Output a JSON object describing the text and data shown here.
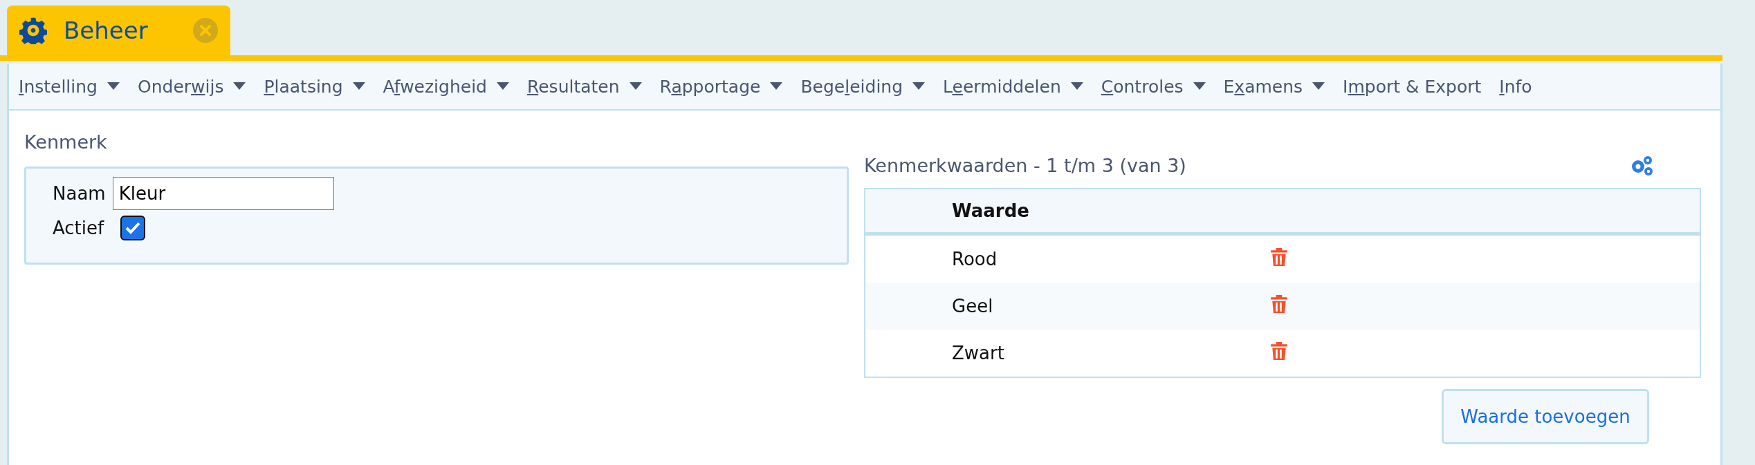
{
  "tab": {
    "title": "Beheer"
  },
  "menu": [
    {
      "key": "I",
      "after": "nstelling",
      "has_menu": true
    },
    {
      "before": "Onder",
      "key": "w",
      "after": "ijs",
      "has_menu": true
    },
    {
      "key": "P",
      "after": "laatsing",
      "has_menu": true
    },
    {
      "before": "A",
      "key": "f",
      "after": "wezigheid",
      "has_menu": true
    },
    {
      "key": "R",
      "after": "esultaten",
      "has_menu": true
    },
    {
      "before": "R",
      "key": "a",
      "after": "pportage",
      "has_menu": true
    },
    {
      "before": "Bege",
      "key": "l",
      "after": "eiding",
      "has_menu": true
    },
    {
      "before": "L",
      "key": "e",
      "after": "ermiddelen",
      "has_menu": true
    },
    {
      "key": "C",
      "after": "ontroles",
      "has_menu": true
    },
    {
      "before": "E",
      "key": "x",
      "after": "amens",
      "has_menu": true
    },
    {
      "before": "I",
      "key": "m",
      "after": "port & Export",
      "has_menu": false
    },
    {
      "key": "I",
      "after": "nfo",
      "has_menu": false
    }
  ],
  "kenmerk": {
    "title": "Kenmerk",
    "name_label": "Naam",
    "name_value": "Kleur",
    "active_label": "Actief",
    "active": true
  },
  "values": {
    "title": "Kenmerkwaarden - 1 t/m 3 (van 3)",
    "column": "Waarde",
    "rows": [
      {
        "value": "Rood"
      },
      {
        "value": "Geel"
      },
      {
        "value": "Zwart"
      }
    ],
    "add_button": "Waarde toevoegen"
  }
}
